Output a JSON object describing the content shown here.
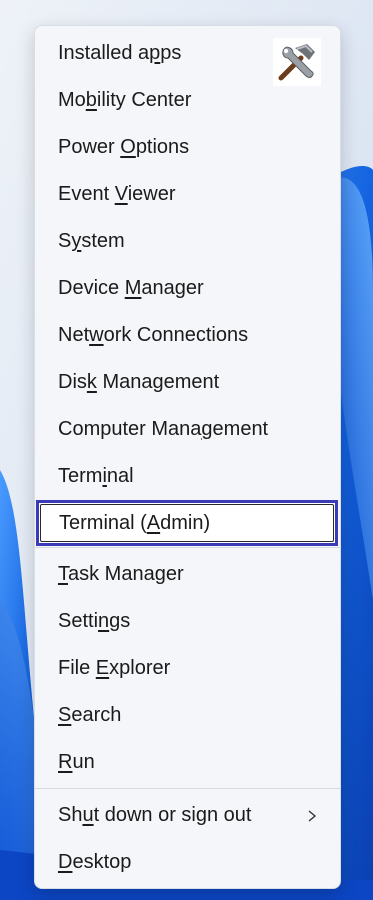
{
  "menu": {
    "items": [
      {
        "id": "installed-apps",
        "pre": "Installed a",
        "key": "p",
        "post": "ps"
      },
      {
        "id": "mobility-center",
        "pre": "Mo",
        "key": "b",
        "post": "ility Center"
      },
      {
        "id": "power-options",
        "pre": "Power ",
        "key": "O",
        "post": "ptions"
      },
      {
        "id": "event-viewer",
        "pre": "Event ",
        "key": "V",
        "post": "iewer"
      },
      {
        "id": "system",
        "pre": "S",
        "key": "y",
        "post": "stem"
      },
      {
        "id": "device-manager",
        "pre": "Device ",
        "key": "M",
        "post": "anager"
      },
      {
        "id": "network-connections",
        "pre": "Net",
        "key": "w",
        "post": "ork Connections"
      },
      {
        "id": "disk-management",
        "pre": "Dis",
        "key": "k",
        "post": " Management"
      },
      {
        "id": "computer-management",
        "pre": "Computer Mana",
        "key": "g",
        "post": "ement"
      },
      {
        "id": "terminal",
        "pre": "Term",
        "key": "i",
        "post": "nal"
      },
      {
        "id": "terminal-admin",
        "pre": "Terminal (",
        "key": "A",
        "post": "dmin)"
      },
      {
        "id": "task-manager",
        "pre": "",
        "key": "T",
        "post": "ask Manager"
      },
      {
        "id": "settings",
        "pre": "Setti",
        "key": "n",
        "post": "gs"
      },
      {
        "id": "file-explorer",
        "pre": "File ",
        "key": "E",
        "post": "xplorer"
      },
      {
        "id": "search",
        "pre": "",
        "key": "S",
        "post": "earch"
      },
      {
        "id": "run",
        "pre": "",
        "key": "R",
        "post": "un"
      },
      {
        "id": "shut-down",
        "pre": "Sh",
        "key": "u",
        "post": "t down or sign out"
      },
      {
        "id": "desktop",
        "pre": "",
        "key": "D",
        "post": "esktop"
      }
    ],
    "selected": "terminal-admin",
    "submenu_arrow_icon": "chevron-right-icon"
  },
  "logo_icon": "hammer-wrench-icon",
  "colors": {
    "selection_border": "#3b3bb7",
    "menu_background": "#f4f6f9",
    "wallpaper_blue": "#1f6fe8"
  }
}
